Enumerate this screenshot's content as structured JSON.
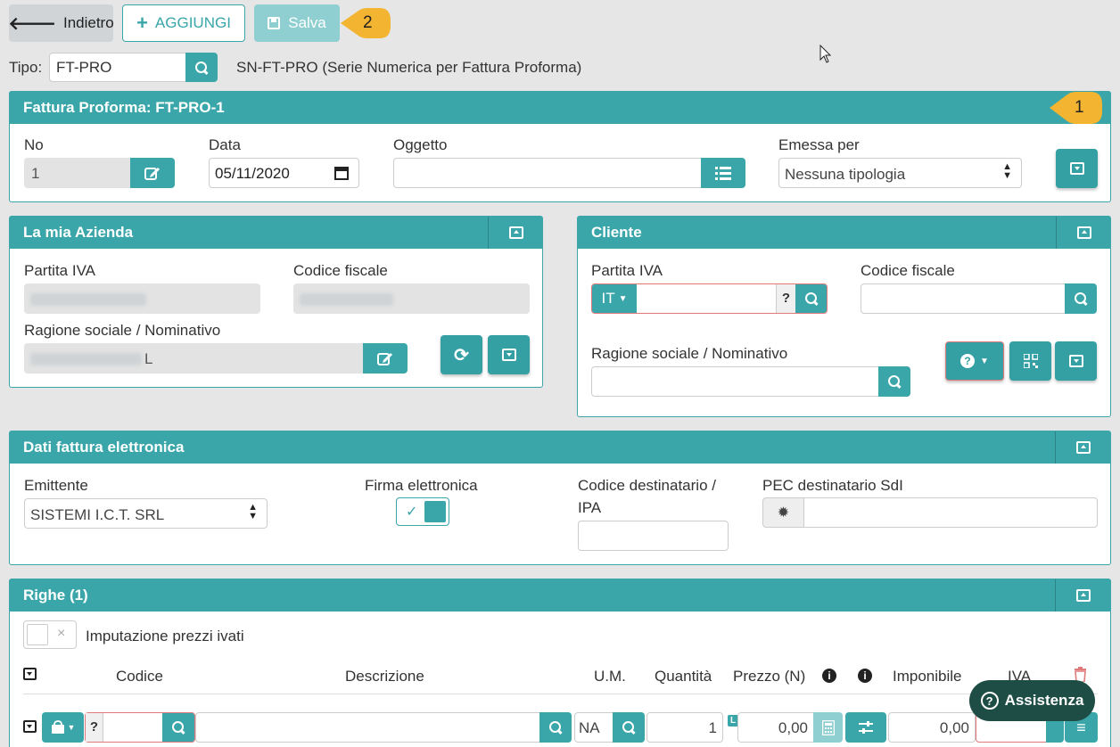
{
  "toolbar": {
    "back_label": "Indietro",
    "add_label": "AGGIUNGI",
    "save_label": "Salva",
    "callout_save": "2",
    "callout_header": "1"
  },
  "tipo": {
    "label": "Tipo:",
    "value": "FT-PRO",
    "description": "SN-FT-PRO (Serie Numerica per Fattura Proforma)"
  },
  "header_panel": {
    "title": "Fattura Proforma: FT-PRO-1",
    "no_label": "No",
    "no_value": "1",
    "data_label": "Data",
    "data_value": "05/11/2020",
    "oggetto_label": "Oggetto",
    "oggetto_value": "",
    "emessa_label": "Emessa per",
    "emessa_value": "Nessuna tipologia"
  },
  "azienda": {
    "title": "La mia Azienda",
    "piva_label": "Partita IVA",
    "cf_label": "Codice fiscale",
    "ragione_label": "Ragione sociale / Nominativo",
    "ragione_suffix": "L"
  },
  "cliente": {
    "title": "Cliente",
    "piva_label": "Partita IVA",
    "country": "IT",
    "help_mark": "?",
    "cf_label": "Codice fiscale",
    "ragione_label": "Ragione sociale / Nominativo"
  },
  "fe": {
    "title": "Dati fattura elettronica",
    "emittente_label": "Emittente",
    "emittente_value": "SISTEMI I.C.T. SRL",
    "firma_label": "Firma elettronica",
    "firma_checked": true,
    "codice_label_1": "Codice destinatario /",
    "codice_label_2": "IPA",
    "pec_label": "PEC destinatario SdI"
  },
  "righe": {
    "title": "Righe (1)",
    "imputazione_label": "Imputazione prezzi ivati",
    "columns": [
      "Codice",
      "Descrizione",
      "U.M.",
      "Quantità",
      "Prezzo (N)",
      "Imponibile",
      "IVA"
    ],
    "row": {
      "help_mark": "?",
      "um": "NA",
      "quantita": "1",
      "prezzo_badge": "L",
      "prezzo": "0,00",
      "imponibile": "0,00"
    }
  },
  "assistenza_label": "Assistenza",
  "colors": {
    "accent": "#3aa6a9",
    "callout": "#f2b431",
    "danger": "#e07a7a"
  }
}
